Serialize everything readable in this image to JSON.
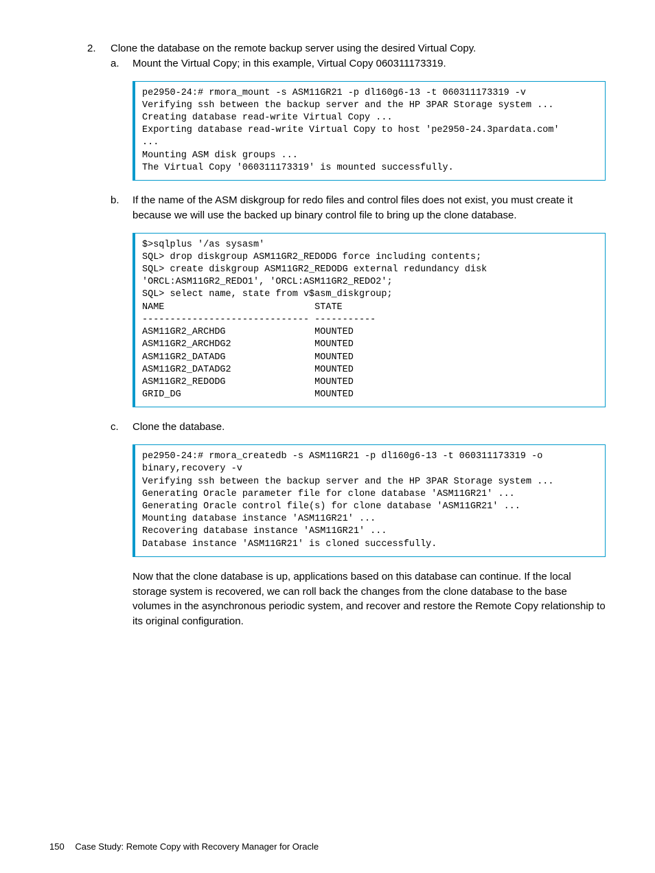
{
  "step_number": "2.",
  "step_text": "Clone the database on the remote backup server using the desired Virtual Copy.",
  "sub_a_letter": "a.",
  "sub_a_text": "Mount the Virtual Copy; in this example, Virtual Copy 060311173319.",
  "code_a": "pe2950-24:# rmora_mount -s ASM11GR21 -p dl160g6-13 -t 060311173319 -v\nVerifying ssh between the backup server and the HP 3PAR Storage system ...\nCreating database read-write Virtual Copy ...\nExporting database read-write Virtual Copy to host 'pe2950-24.3pardata.com'\n...\nMounting ASM disk groups ...\nThe Virtual Copy '060311173319' is mounted successfully.",
  "sub_b_letter": "b.",
  "sub_b_text": "If the name of the ASM diskgroup for redo files and control files does not exist, you must create it because we will use the backed up binary control file to bring up the clone database.",
  "code_b": "$>sqlplus '/as sysasm'\nSQL> drop diskgroup ASM11GR2_REDODG force including contents;\nSQL> create diskgroup ASM11GR2_REDODG external redundancy disk\n'ORCL:ASM11GR2_REDO1', 'ORCL:ASM11GR2_REDO2';\nSQL> select name, state from v$asm_diskgroup;\nNAME                           STATE\n------------------------------ -----------\nASM11GR2_ARCHDG                MOUNTED\nASM11GR2_ARCHDG2               MOUNTED\nASM11GR2_DATADG                MOUNTED\nASM11GR2_DATADG2               MOUNTED\nASM11GR2_REDODG                MOUNTED\nGRID_DG                        MOUNTED",
  "sub_c_letter": "c.",
  "sub_c_text": "Clone the database.",
  "code_c": "pe2950-24:# rmora_createdb -s ASM11GR21 -p dl160g6-13 -t 060311173319 -o\nbinary,recovery -v\nVerifying ssh between the backup server and the HP 3PAR Storage system ...\nGenerating Oracle parameter file for clone database 'ASM11GR21' ...\nGenerating Oracle control file(s) for clone database 'ASM11GR21' ...\nMounting database instance 'ASM11GR21' ...\nRecovering database instance 'ASM11GR21' ...\nDatabase instance 'ASM11GR21' is cloned successfully.",
  "closing_paragraph": "Now that the clone database is up, applications based on this database can continue. If the local storage system is recovered, we can roll back the changes from the clone database to the base volumes in the asynchronous periodic system, and recover and restore the Remote Copy relationship to its original configuration.",
  "footer_page": "150",
  "footer_title": "Case Study: Remote Copy with Recovery Manager for Oracle"
}
